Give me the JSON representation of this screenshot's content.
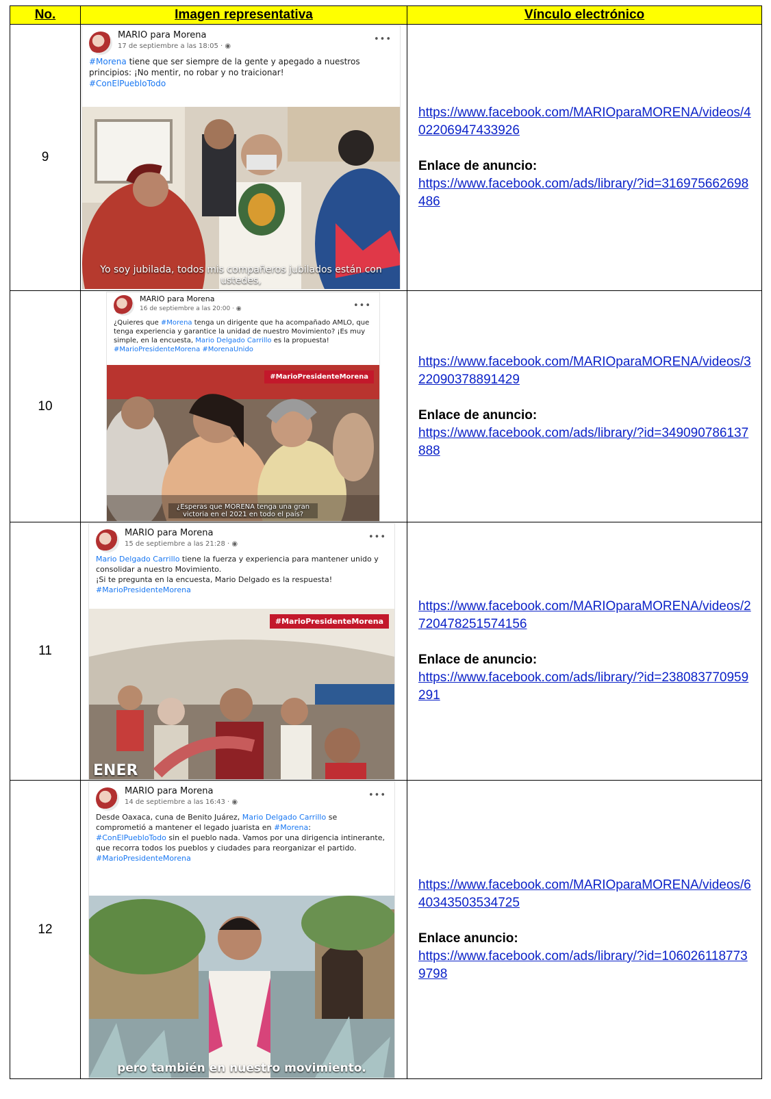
{
  "headers": {
    "no": "No.",
    "image": "Imagen representativa",
    "link": "Vínculo electrónico"
  },
  "rows": [
    {
      "no": "9",
      "post": {
        "page": "MARIO para Morena",
        "date": "17 de septiembre a las 18:05 · ",
        "text_parts": [
          "#Morena",
          " tiene que ser siempre de la gente y apegado a nuestros principios: ¡No mentir, no robar y no traicionar!",
          "#ConElPuebloTodo"
        ],
        "caption": "Yo soy jubilada, todos mis compañeros jubilados están con ustedes,"
      },
      "video_url": "https://www.facebook.com/MARIOparaMORENA/videos/402206947433926",
      "ad_label": "Enlace de anuncio:",
      "ad_url": "https://www.facebook.com/ads/library/?id=316975662698486"
    },
    {
      "no": "10",
      "post": {
        "page": "MARIO para Morena",
        "date": "16 de septiembre a las 20:00 · ",
        "text_parts": [
          "¿Quieres que ",
          "#Morena",
          " tenga un dirigente que ha acompañado AMLO, que tenga experiencia y garantice la unidad de nuestro Movimiento? ¡Es muy simple, en la encuesta, ",
          "Mario Delgado Carrillo",
          " es la propuesta!",
          "#MarioPresidenteMorena #MorenaUnido"
        ],
        "badge": "#MarioPresidenteMorena",
        "caption": "¿Esperas que MORENA tenga una gran victoria en el 2021 en todo el país?"
      },
      "video_url": "https://www.facebook.com/MARIOparaMORENA/videos/322090378891429",
      "ad_label": "Enlace de anuncio:",
      "ad_url": "https://www.facebook.com/ads/library/?id=349090786137888"
    },
    {
      "no": "11",
      "post": {
        "page": "MARIO para Morena",
        "date": "15 de septiembre a las 21:28 · ",
        "text_parts": [
          "Mario Delgado Carrillo",
          " tiene la fuerza y experiencia para mantener unido y consolidar a nuestro Movimiento.",
          "¡Si te pregunta en la encuesta, Mario Delgado es la respuesta!",
          "#MarioPresidenteMorena"
        ],
        "badge": "#MarioPresidenteMorena",
        "caption": "ENER"
      },
      "video_url": "https://www.facebook.com/MARIOparaMORENA/videos/2720478251574156",
      "ad_label": "Enlace de anuncio:",
      "ad_url": "https://www.facebook.com/ads/library/?id=238083770959291"
    },
    {
      "no": "12",
      "post": {
        "page": "MARIO para Morena",
        "date": "14 de septiembre a las 16:43 · ",
        "text_parts": [
          "Desde Oaxaca, cuna de Benito Juárez, ",
          "Mario Delgado Carrillo",
          " se comprometió a mantener el legado juarista en ",
          "#Morena",
          ":",
          "#ConElPuebloTodo",
          " sin el pueblo nada. Vamos por una dirigencia intinerante, que recorra todos los pueblos y ciudades para reorganizar el partido.",
          "#MarioPresidenteMorena"
        ],
        "caption": "pero también en nuestro movimiento."
      },
      "video_url": "https://www.facebook.com/MARIOparaMORENA/videos/640343503534725",
      "ad_label": "Enlace anuncio:",
      "ad_url": "https://www.facebook.com/ads/library/?id=1060261187739798"
    }
  ]
}
